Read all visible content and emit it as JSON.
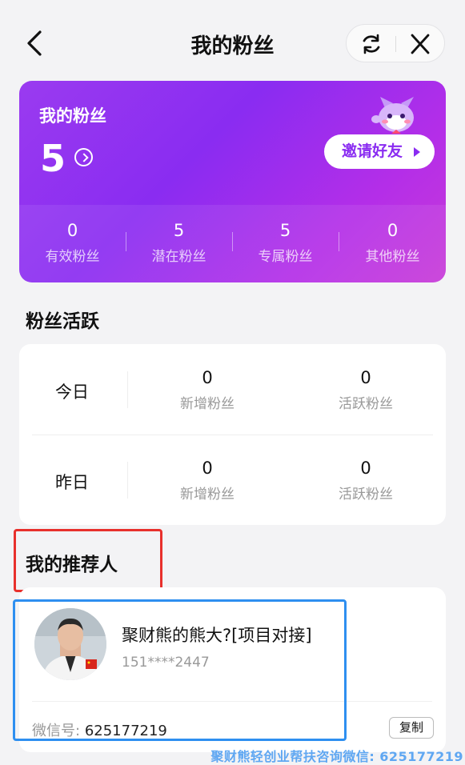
{
  "header": {
    "title": "我的粉丝"
  },
  "fans_card": {
    "title": "我的粉丝",
    "count": "5",
    "invite_label": "邀请好友",
    "stats": [
      {
        "value": "0",
        "label": "有效粉丝"
      },
      {
        "value": "5",
        "label": "潜在粉丝"
      },
      {
        "value": "5",
        "label": "专属粉丝"
      },
      {
        "value": "0",
        "label": "其他粉丝"
      }
    ],
    "gradient": [
      "#9a3bf0",
      "#c83ad8"
    ]
  },
  "activity": {
    "title": "粉丝活跃",
    "rows": [
      {
        "day": "今日",
        "new_value": "0",
        "new_label": "新增粉丝",
        "active_value": "0",
        "active_label": "活跃粉丝"
      },
      {
        "day": "昨日",
        "new_value": "0",
        "new_label": "新增粉丝",
        "active_value": "0",
        "active_label": "活跃粉丝"
      }
    ]
  },
  "referrer": {
    "title": "我的推荐人",
    "name": "聚财熊的熊大?[项目对接]",
    "phone": "151****2447",
    "wechat_label": "微信号:",
    "wechat_value": "625177219",
    "copy_label": "复制"
  },
  "watermark": "聚财熊轻创业帮扶咨询微信: 625177219",
  "colors": {
    "accent": "#8a2cf1",
    "highlight_red": "#e8302c",
    "highlight_blue": "#2e8ff0"
  }
}
